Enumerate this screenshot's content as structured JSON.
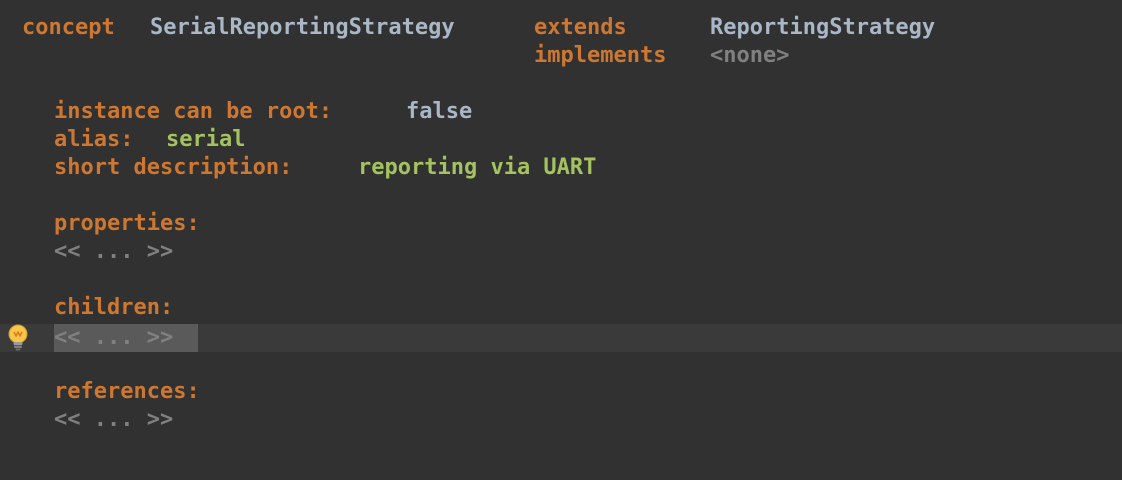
{
  "header": {
    "concept_kw": "concept",
    "concept_name": "SerialReportingStrategy",
    "extends_kw": "extends",
    "extends_value": "ReportingStrategy",
    "implements_kw": "implements",
    "implements_value": "<none>"
  },
  "attributes": {
    "root_label": "instance can be root:",
    "root_value": "false",
    "alias_label": "alias:",
    "alias_value": "serial",
    "desc_label": "short description:",
    "desc_value": "reporting via UART"
  },
  "sections": [
    {
      "label": "properties:",
      "placeholder": "<< ... >>"
    },
    {
      "label": "children:",
      "placeholder": "<< ... >>"
    },
    {
      "label": "references:",
      "placeholder": "<< ... >>"
    }
  ],
  "colors": {
    "background": "#313131",
    "keyword": "#cc7832",
    "identifier": "#a9b7c6",
    "string_value": "#a5c261",
    "placeholder": "#808080"
  },
  "icons": {
    "intention": "lightbulb-icon"
  }
}
